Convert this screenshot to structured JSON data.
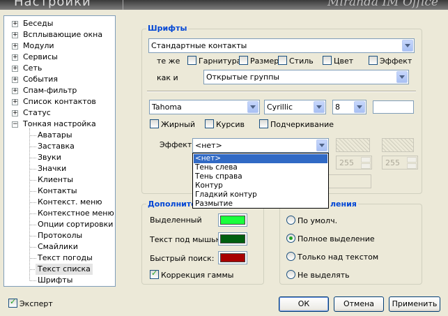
{
  "header": {
    "title": "Настройки",
    "logo": "Miranda IM Office"
  },
  "tree": {
    "items": [
      {
        "label": "Беседы",
        "expander": "+"
      },
      {
        "label": "Всплывающие окна",
        "expander": "+"
      },
      {
        "label": "Модули",
        "expander": "+"
      },
      {
        "label": "Сервисы",
        "expander": "+"
      },
      {
        "label": "Сеть",
        "expander": "+"
      },
      {
        "label": "События",
        "expander": "+"
      },
      {
        "label": "Спам-фильтр",
        "expander": "+"
      },
      {
        "label": "Список контактов",
        "expander": "+"
      },
      {
        "label": "Статус",
        "expander": "+"
      },
      {
        "label": "Тонкая настройка",
        "expander": "−"
      }
    ],
    "children": [
      "Аватары",
      "Заставка",
      "Звуки",
      "Значки",
      "Клиенты",
      "Контакты",
      "Контекст. меню",
      "Контекстное меню",
      "Опции сортировки",
      "Протоколы",
      "Смайлики",
      "Текст погоды",
      "Текст списка",
      "Шрифты"
    ],
    "selected_child": "Текст списка"
  },
  "fonts": {
    "title": "Шрифты",
    "contact_type": "Стандартные контакты",
    "same_as": "те же",
    "same_checks": [
      "Гарнитура",
      "Размер",
      "Стиль",
      "Цвет",
      "Эффект"
    ],
    "as_label": "как и",
    "as_group": "Открытые группы",
    "font_name": "Tahoma",
    "charset": "Cyrillic",
    "size": "8",
    "bold": "Жирный",
    "italic": "Курсив",
    "underline": "Подчеркивание",
    "effect_label": "Эффект",
    "effect_value": "<нет>",
    "spin1": "255",
    "spin2": "255"
  },
  "effect_dropdown": {
    "options": [
      "<нет>",
      "Тень слева",
      "Тень справа",
      "Контур",
      "Гладкий контур",
      "Размытие"
    ],
    "highlighted": 0
  },
  "extra": {
    "title": "Дополните",
    "selected": "Выделенный",
    "hover_text": "Текст под мышью:",
    "quick_search": "Быстрый поиск:",
    "gamma": "Коррекция гаммы",
    "colors": {
      "selected": "#1aff3c",
      "hover": "#005f0f",
      "quick": "#a80000"
    }
  },
  "selection": {
    "title": "ления",
    "options": [
      "По умолч.",
      "Полное выделение",
      "Только над текстом",
      "Не выделять"
    ],
    "checked": 1
  },
  "footer": {
    "expert": "Эксперт",
    "ok": "ОК",
    "cancel": "Отмена",
    "apply": "Применить"
  }
}
